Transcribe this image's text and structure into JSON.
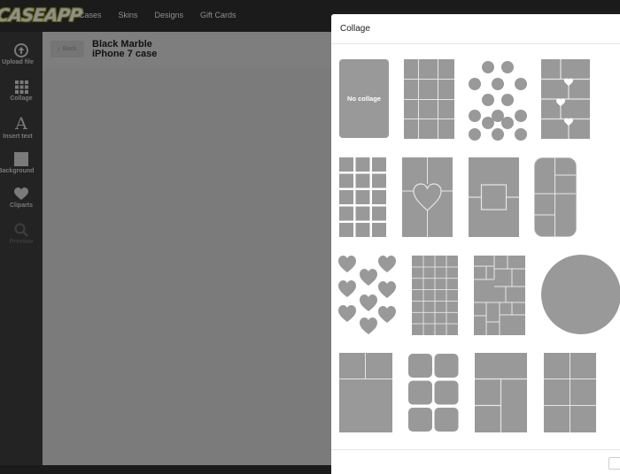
{
  "brand": {
    "logo_text": "CASEAPP"
  },
  "nav": {
    "items": [
      {
        "label": "Cases"
      },
      {
        "label": "Skins"
      },
      {
        "label": "Designs"
      },
      {
        "label": "Gift Cards"
      }
    ]
  },
  "sidebar": {
    "items": [
      {
        "label": "Upload file",
        "icon": "upload-icon"
      },
      {
        "label": "Collage",
        "icon": "grid-icon"
      },
      {
        "label": "Insert text",
        "icon": "text-icon"
      },
      {
        "label": "Background",
        "icon": "square-icon"
      },
      {
        "label": "Cliparts",
        "icon": "heart-icon"
      },
      {
        "label": "Preview",
        "icon": "search-icon",
        "disabled": true
      }
    ]
  },
  "editor": {
    "back_label": "Back",
    "product_title_line1": "Black Marble",
    "product_title_line2": "iPhone 7 case"
  },
  "modal": {
    "title": "Collage",
    "no_collage_label": "No collage",
    "layouts": [
      "no-collage",
      "grid-3x4",
      "circles-15",
      "hearts-bricks",
      "squares-3x5",
      "center-heart",
      "center-square",
      "stamp-edge",
      "hearts-9",
      "grid-4x7",
      "mosaic-mixed",
      "circle",
      "two-top-one-bottom",
      "rough-6",
      "one-top-three-bottom",
      "grid-2x3"
    ]
  },
  "colors": {
    "tile_fill": "#999999",
    "tile_line": "#e6e6e6",
    "topbar": "#1b1b1b",
    "sidebar": "#232323",
    "overlay": "#7b7b7b"
  }
}
